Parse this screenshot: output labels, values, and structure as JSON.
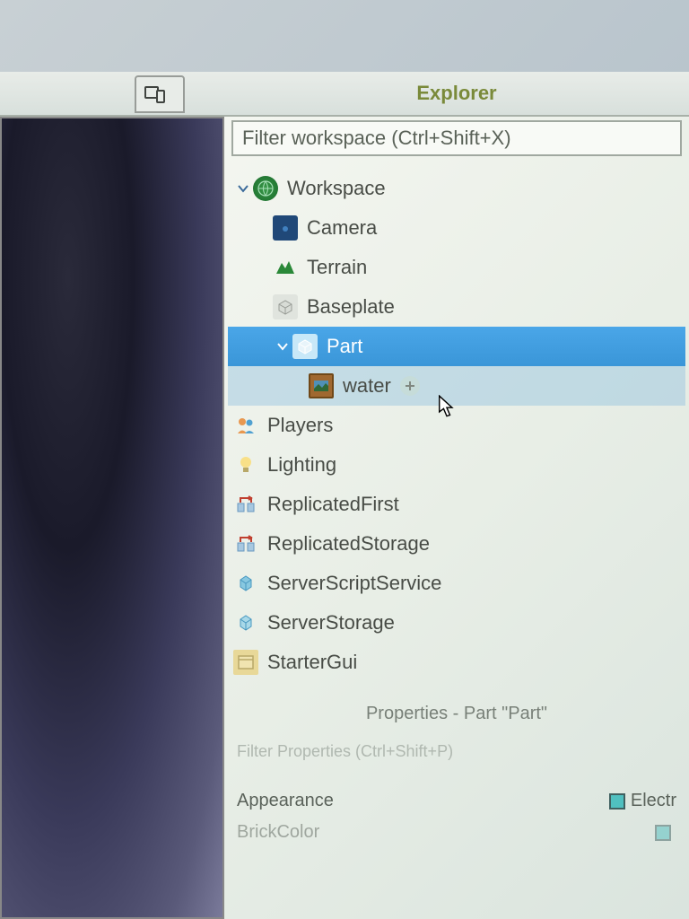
{
  "panel_title": "Explorer",
  "filter_placeholder": "Filter workspace (Ctrl+Shift+X)",
  "tree": {
    "workspace": "Workspace",
    "camera": "Camera",
    "terrain": "Terrain",
    "baseplate": "Baseplate",
    "part": "Part",
    "water": "water",
    "players": "Players",
    "lighting": "Lighting",
    "replicated_first": "ReplicatedFirst",
    "replicated_storage": "ReplicatedStorage",
    "server_script_service": "ServerScriptService",
    "server_storage": "ServerStorage",
    "starter_gui": "StarterGui"
  },
  "properties": {
    "title": "Properties - Part \"Part\"",
    "filter_placeholder": "Filter Properties (Ctrl+Shift+P)",
    "section_appearance": "Appearance",
    "row_brickcolor": "BrickColor",
    "value_electric": "Electr"
  }
}
